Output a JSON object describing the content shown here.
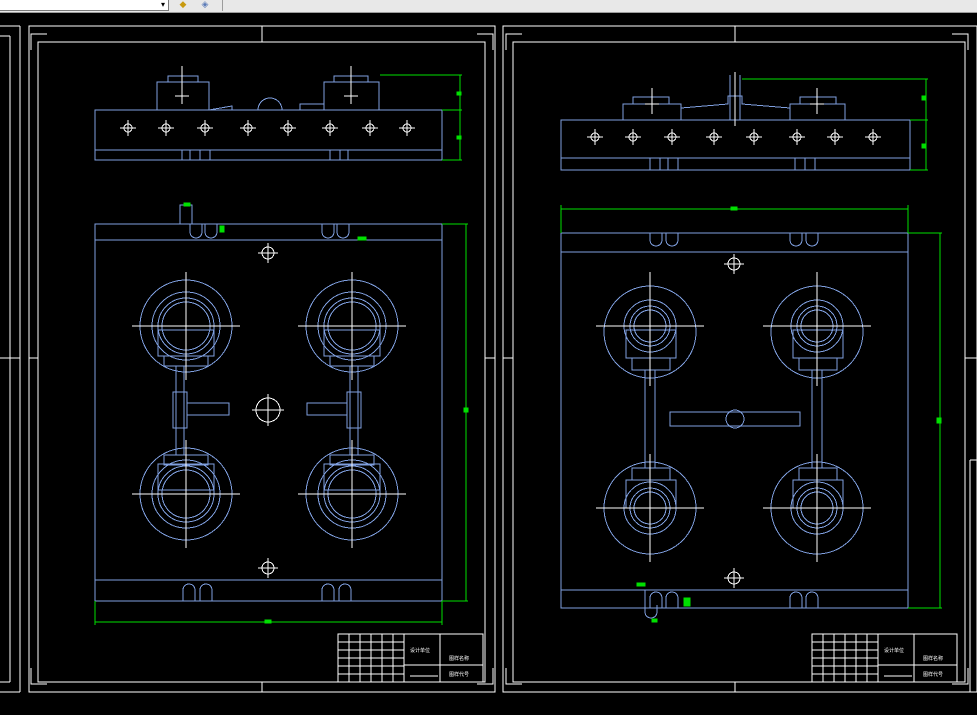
{
  "toolbar": {
    "layer_combo": {
      "value": ""
    },
    "icons": [
      "layer-state-icon",
      "layer-properties-icon"
    ]
  },
  "drawing": {
    "colors": {
      "background": "#000000",
      "frame": "#ffffff",
      "geometry": "#7f9fdf",
      "dimension": "#00e000",
      "centerline": "#ffffff"
    },
    "sheets": [
      {
        "name": "left-sheet",
        "title_block": {
          "label_1": "图样名称",
          "label_2": "图样代号",
          "label_3": "设计单位"
        }
      },
      {
        "name": "right-sheet",
        "title_block": {
          "label_1": "图样名称",
          "label_2": "图样代号",
          "label_3": "设计单位"
        }
      }
    ]
  }
}
